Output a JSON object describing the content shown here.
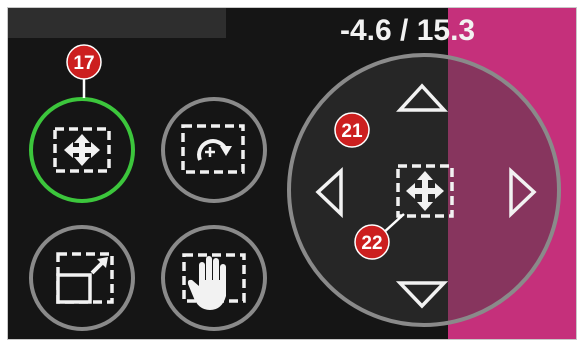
{
  "coords_text": "-4.6 / 15.3",
  "colors": {
    "background": "#151515",
    "top_bar": "#2e2e2e",
    "magenta": "#c5307b",
    "ring": "#8a8a8a",
    "selected_ring": "#3cc63c",
    "icon": "#f2f2f2",
    "callout": "#cc1f1f",
    "frame": "#c8c8c8"
  },
  "buttons": [
    {
      "name": "move-mode-button",
      "icon": "move-arrows-icon",
      "selected": true
    },
    {
      "name": "rotate-mode-button",
      "icon": "rotate-icon",
      "selected": false
    },
    {
      "name": "resize-mode-button",
      "icon": "resize-icon",
      "selected": false
    },
    {
      "name": "pan-mode-button",
      "icon": "hand-icon",
      "selected": false
    }
  ],
  "callouts": [
    {
      "label": "17",
      "target": "move-mode-button"
    },
    {
      "label": "21",
      "target": "direction-pad"
    },
    {
      "label": "22",
      "target": "center-move-button"
    }
  ],
  "direction_pad": {
    "arrows": [
      "up",
      "down",
      "left",
      "right"
    ],
    "center_icon": "move-arrows-icon"
  }
}
